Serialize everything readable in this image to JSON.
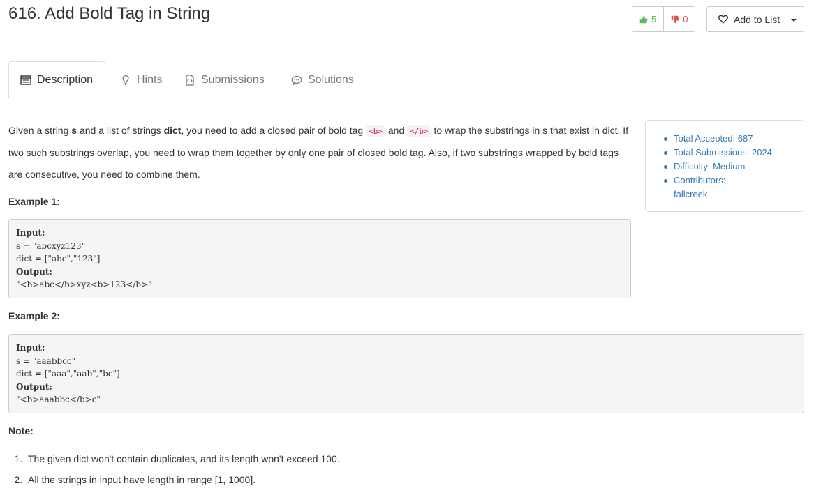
{
  "problem": {
    "title": "616. Add Bold Tag in String",
    "upvotes": "5",
    "downvotes": "0",
    "add_to_list": "Add to List"
  },
  "tabs": [
    {
      "label": "Description",
      "icon": "description-icon"
    },
    {
      "label": "Hints",
      "icon": "lightbulb-icon"
    },
    {
      "label": "Submissions",
      "icon": "code-file-icon"
    },
    {
      "label": "Solutions",
      "icon": "comment-icon"
    }
  ],
  "description": {
    "p1": "Given a string",
    "s_bold": "s",
    "p2": "and a list of strings",
    "dict_bold": "dict",
    "p3": ", you need to add a closed pair of bold tag",
    "open_tag": "<b>",
    "p4": "and",
    "close_tag": "</b>",
    "p5": "to wrap the substrings in s that exist in dict. If two such substrings overlap, you need to wrap them together by only one pair of closed bold tag. Also, if two substrings wrapped by bold tags are consecutive, you need to combine them."
  },
  "examples": [
    {
      "heading": "Example 1:",
      "input_label": "Input:",
      "line1": "s = \"abcxyz123\"",
      "line2": "dict = [\"abc\",\"123\"]",
      "output_label": "Output:",
      "output": "\"<b>abc</b>xyz<b>123</b>\""
    },
    {
      "heading": "Example 2:",
      "input_label": "Input:",
      "line1": "s = \"aaabbcc\"",
      "line2": "dict = [\"aaa\",\"aab\",\"bc\"]",
      "output_label": "Output:",
      "output": "\"<b>aaabbc</b>c\""
    }
  ],
  "note": {
    "heading": "Note:",
    "items": [
      "The given dict won't contain duplicates, and its length won't exceed 100.",
      "All the strings in input have length in range [1, 1000]."
    ]
  },
  "stats": {
    "accepted": "Total Accepted: 687",
    "submissions": "Total Submissions: 2024",
    "difficulty": "Difficulty: Medium",
    "contributors_label": "Contributors:",
    "contributor": "fallcreek"
  },
  "colors": {
    "link": "#337ab7",
    "upvote": "#5cb85c",
    "downvote": "#d9534f",
    "inline_code": "#c7254e"
  }
}
